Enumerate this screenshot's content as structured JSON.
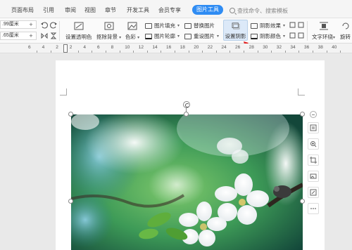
{
  "tabs": [
    {
      "label": "页面布局"
    },
    {
      "label": "引用"
    },
    {
      "label": "审阅"
    },
    {
      "label": "视图"
    },
    {
      "label": "章节"
    },
    {
      "label": "开发工具"
    },
    {
      "label": "会员专享"
    }
  ],
  "active_tab": "图片工具",
  "search": {
    "placeholder": "查找命令、搜索模板"
  },
  "toolbar": {
    "height_value": ".99厘米",
    "width_value": ".65厘米",
    "set_transparent": "设置透明色",
    "remove_bg": "抠除背景",
    "color": "色彩",
    "image_fill": "图片填充",
    "image_outline": "图片轮廓",
    "replace_image": "替换图片",
    "reset_image": "重设图片",
    "set_shadow": "设置阴影",
    "shadow_effect": "阴影效果",
    "shadow_color": "阴影颜色",
    "text_wrap": "文字环绕",
    "rotate": "旋转"
  },
  "ruler": {
    "numbers": [
      "6",
      "4",
      "2",
      "2",
      "4",
      "6",
      "8",
      "10",
      "12",
      "14",
      "16",
      "18",
      "20",
      "22",
      "24",
      "26",
      "28",
      "30",
      "32",
      "34",
      "36",
      "38",
      "40"
    ]
  },
  "colors": {
    "accent": "#2f8cf3",
    "arrow": "#e02020"
  },
  "icons": [
    "zoom-out-icon",
    "layout-icon",
    "zoom-in-icon",
    "crop-icon",
    "image-icon",
    "image-edit-icon",
    "more-icon",
    "rotate-handle-icon"
  ]
}
